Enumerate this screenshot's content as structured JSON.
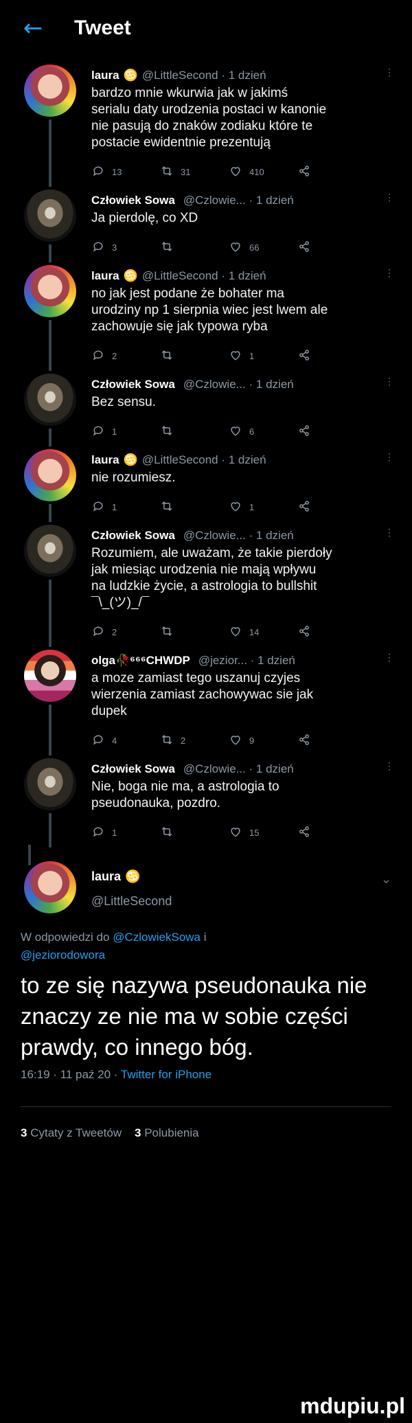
{
  "header": {
    "back": "←",
    "title": "Tweet"
  },
  "tweets": [
    {
      "name": "laura",
      "badge": "♋",
      "handle": "@LittleSecond · 1 dzień",
      "text": "bardzo mnie wkurwia jak w jakimś\nserialu daty urodzenia postaci w kanonie\nnie pasują do znaków zodiaku które te\npostacie ewidentnie prezentują",
      "reply": "13",
      "retweet": "31",
      "like": "410"
    },
    {
      "name": "Człowiek Sowa",
      "badge": "",
      "handle": "@Czlowie... · 1 dzień",
      "text": "Ja pierdolę, co XD",
      "reply": "3",
      "retweet": "",
      "like": "66"
    },
    {
      "name": "laura",
      "badge": "♋",
      "handle": "@LittleSecond · 1 dzień",
      "text": "no jak jest podane że bohater ma\nurodziny np 1 sierpnia wiec jest lwem ale\nzachowuje się jak typowa ryba",
      "reply": "2",
      "retweet": "",
      "like": "1"
    },
    {
      "name": "Człowiek Sowa",
      "badge": "",
      "handle": "@Czlowie... · 1 dzień",
      "text": "Bez sensu.",
      "reply": "1",
      "retweet": "",
      "like": "6"
    },
    {
      "name": "laura",
      "badge": "♋",
      "handle": "@LittleSecond · 1 dzień",
      "text": "nie rozumiesz.",
      "reply": "1",
      "retweet": "",
      "like": "1"
    },
    {
      "name": "Człowiek Sowa",
      "badge": "",
      "handle": "@Czlowie... · 1 dzień",
      "text": "Rozumiem, ale uważam, że takie pierdoły\njak miesiąc urodzenia nie mają wpływu\nna ludzkie życie, a astrologia to bullshit\n¯\\_(ツ)_/¯",
      "reply": "2",
      "retweet": "",
      "like": "14"
    },
    {
      "name": "olga🥀⁶⁶⁶CHWDP",
      "badge": "",
      "handle": "@jezior... · 1 dzień",
      "text": "a moze zamiast tego uszanuj czyjes\nwierzenia zamiast zachowywac sie jak\ndupek",
      "reply": "4",
      "retweet": "2",
      "like": "9"
    },
    {
      "name": "Człowiek Sowa",
      "badge": "",
      "handle": "@Czlowie... · 1 dzień",
      "text": "Nie, boga nie ma, a astrologia to\npseudonauka, pozdro.",
      "reply": "1",
      "retweet": "",
      "like": "15"
    }
  ],
  "main": {
    "name": "laura",
    "badge": "♋",
    "handle": "@LittleSecond",
    "replying_prefix": "W odpowiedzi do",
    "replying_user1": "@CzlowiekSowa",
    "replying_and": "i",
    "replying_user2": "@jeziorodowora",
    "text": "to ze się nazywa pseudonauka nie znaczy ze nie ma w sobie części prawdy, co innego bóg.",
    "time": "16:19 · 11 paź 20 ·",
    "client": "Twitter for iPhone",
    "quotes_count": "3",
    "quotes_label": "Cytaty z Tweetów",
    "likes_count": "3",
    "likes_label": "Polubienia"
  },
  "watermark": "mdupiu.pl",
  "colors": {
    "accent": "#1da1f2",
    "background": "#000000",
    "muted": "#8b98a5",
    "thread_line": "#38444d"
  }
}
